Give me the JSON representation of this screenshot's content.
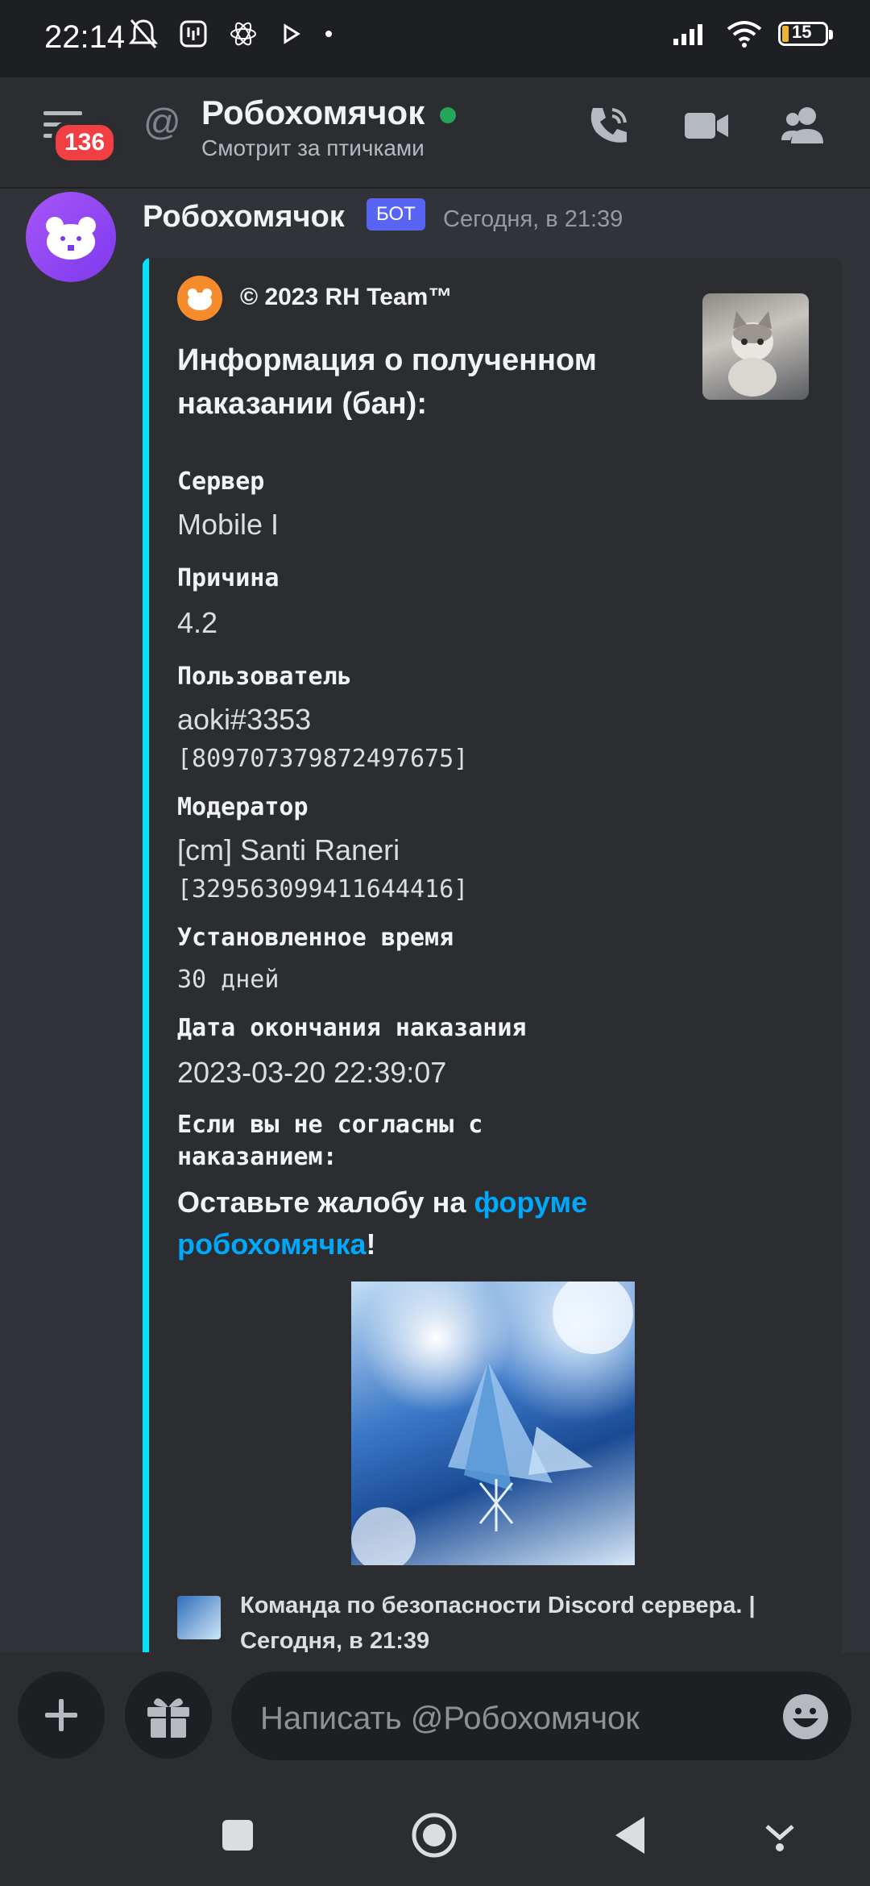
{
  "status_bar": {
    "time": "22:14",
    "battery": "15",
    "icons": [
      "mute-icon",
      "app-icon",
      "signal-icon",
      "wifi-icon",
      "battery-icon"
    ]
  },
  "header": {
    "unread_count": "136",
    "title": "Робохомячок",
    "subtitle": "Смотрит за птичками",
    "actions": [
      "call-icon",
      "video-icon",
      "members-icon"
    ]
  },
  "message": {
    "author": "Робохомячок",
    "bot_tag": "БОТ",
    "timestamp": "Сегодня, в 21:39",
    "embed": {
      "author": "© 2023 RH Team™",
      "title": "Информация о полученном наказании (бан):",
      "fields": {
        "server_name": "Сервер",
        "server_value": "Mobile I",
        "reason_name": "Причина",
        "reason_value": "4.2",
        "user_name": "Пользователь",
        "user_value": "aoki#3353",
        "user_id": "[809707379872497675]",
        "moderator_name": "Модератор",
        "moderator_value": "[cm] Santi Raneri",
        "moderator_id": "[329563099411644416]",
        "duration_name": "Установленное время",
        "duration_value": "30 дней",
        "end_date_name": "Дата окончания наказания",
        "end_date_value": "2023-03-20 22:39:07",
        "disagree_name": "Если вы не согласны с наказанием:",
        "complain_prefix": "Оставьте жалобу на ",
        "complain_link": "форуме робохомячка",
        "complain_suffix": "!"
      },
      "footer": "Команда по безопасности Discord сервера. | Сегодня, в 21:39"
    }
  },
  "input": {
    "placeholder": "Написать @Робохомячок"
  },
  "colors": {
    "background": "#313338",
    "embed_bg": "#2b2d31",
    "embed_accent": "#00e5ff",
    "link": "#00a8fc",
    "bot_tag": "#5865f2",
    "badge": "#f23f43",
    "online": "#23a55a"
  }
}
